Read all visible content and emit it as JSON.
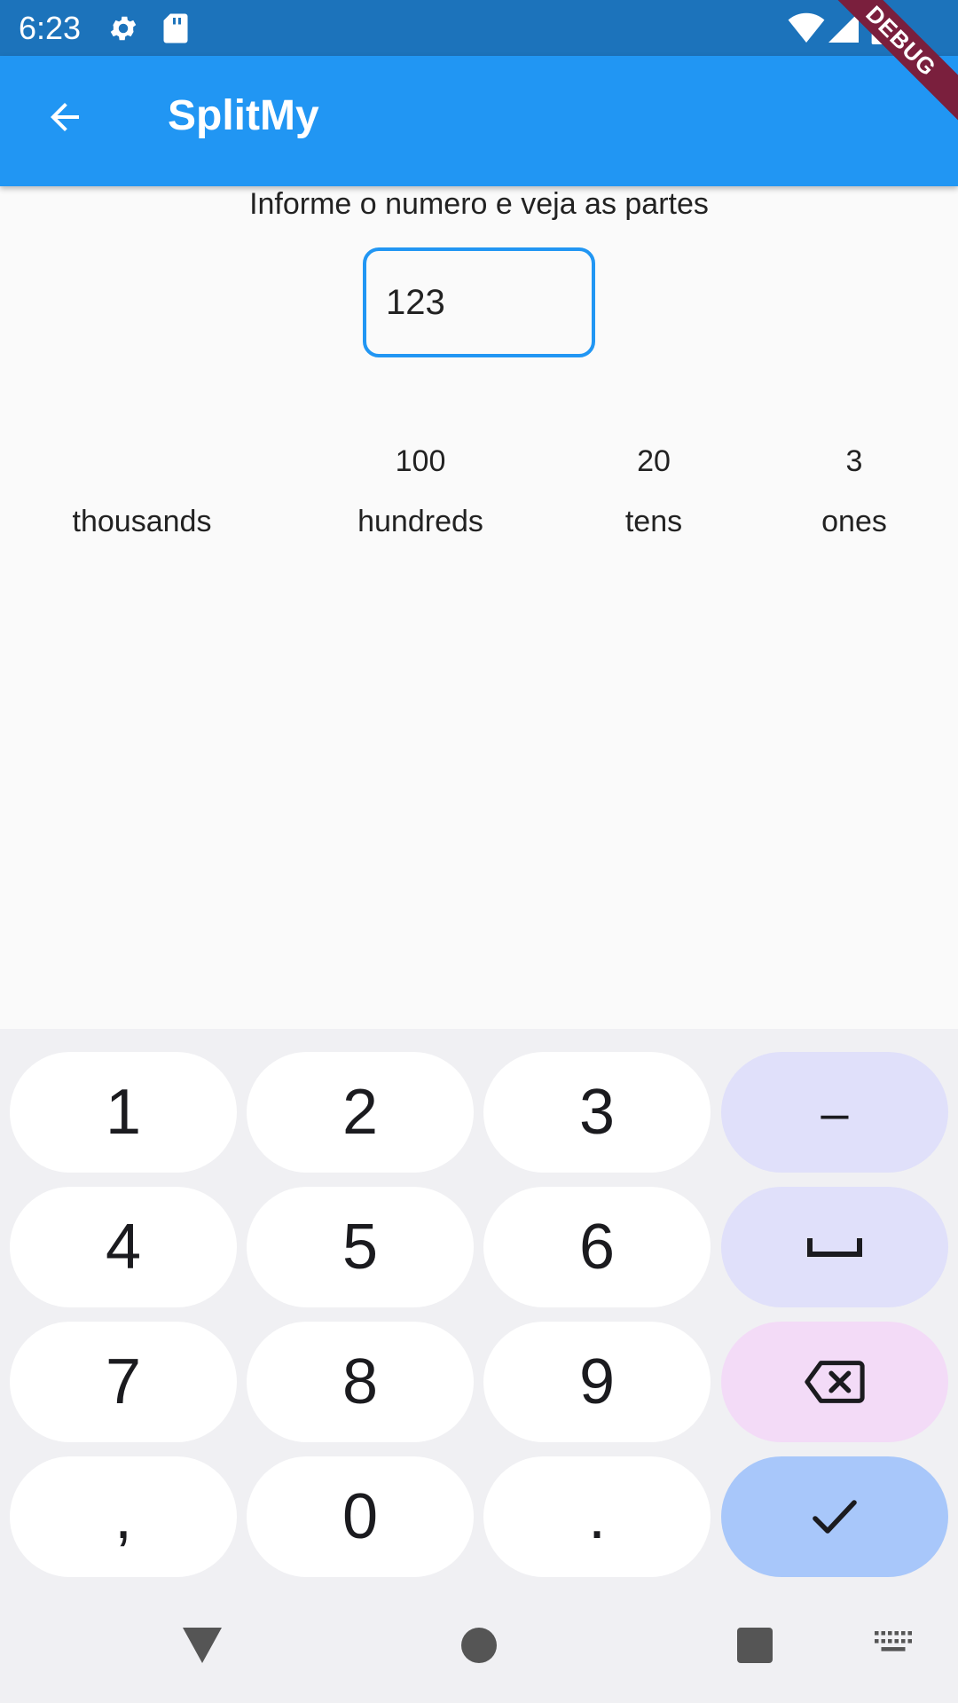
{
  "status_bar": {
    "time": "6:23",
    "icons": [
      "gear-icon",
      "sd-card-icon",
      "wifi-icon",
      "signal-icon",
      "battery-icon"
    ]
  },
  "debug_banner": "DEBUG",
  "app_bar": {
    "title": "SplitMy",
    "back_icon": "arrow-back-icon",
    "color": "#2196f3"
  },
  "main": {
    "instruction": "Informe o numero e veja as partes",
    "input_value": "123",
    "place_values": [
      {
        "value": "",
        "label": "thousands"
      },
      {
        "value": "100",
        "label": "hundreds"
      },
      {
        "value": "20",
        "label": "tens"
      },
      {
        "value": "3",
        "label": "ones"
      }
    ]
  },
  "keyboard": {
    "rows": [
      [
        "1",
        "2",
        "3",
        "–"
      ],
      [
        "4",
        "5",
        "6",
        "space-icon"
      ],
      [
        "7",
        "8",
        "9",
        "backspace-icon"
      ],
      [
        ",",
        "0",
        ".",
        "check-icon"
      ]
    ],
    "key_1": "1",
    "key_2": "2",
    "key_3": "3",
    "key_minus": "–",
    "key_4": "4",
    "key_5": "5",
    "key_6": "6",
    "key_7": "7",
    "key_8": "8",
    "key_9": "9",
    "key_comma": ",",
    "key_0": "0",
    "key_period": "."
  },
  "nav_bar": {
    "icons": [
      "back-triangle-icon",
      "home-circle-icon",
      "recents-square-icon",
      "keyboard-icon"
    ]
  }
}
